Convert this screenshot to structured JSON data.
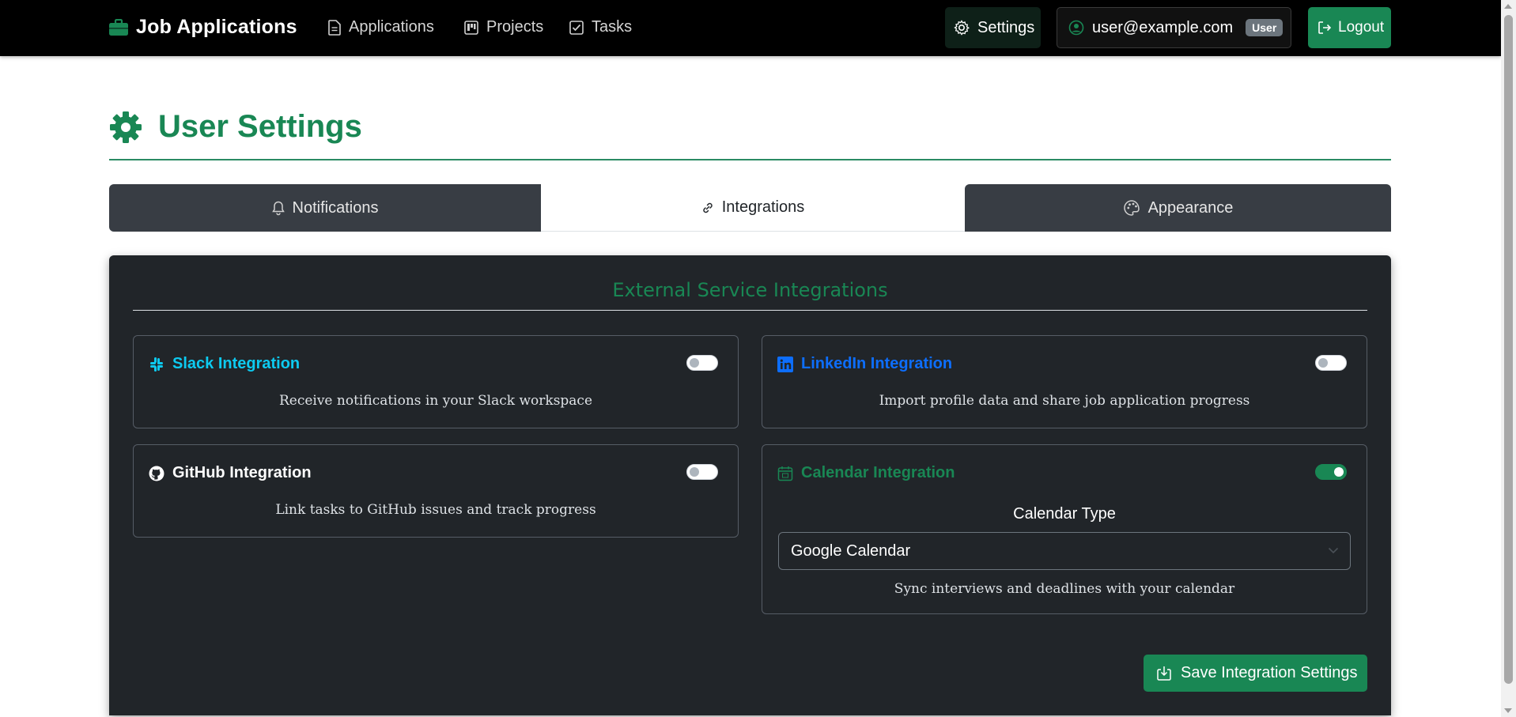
{
  "navbar": {
    "brand": "Job Applications",
    "links": [
      {
        "label": "Applications",
        "icon": "file-text-icon"
      },
      {
        "label": "Projects",
        "icon": "kanban-icon"
      },
      {
        "label": "Tasks",
        "icon": "check-square-icon"
      }
    ],
    "settings_label": "Settings",
    "user_email": "user@example.com",
    "user_role": "User",
    "logout_label": "Logout"
  },
  "page": {
    "title": "User Settings",
    "tabs": [
      {
        "label": "Notifications",
        "icon": "bell-icon",
        "active": false
      },
      {
        "label": "Integrations",
        "icon": "link-icon",
        "active": true
      },
      {
        "label": "Appearance",
        "icon": "palette-icon",
        "active": false
      }
    ]
  },
  "integrations": {
    "heading": "External Service Integrations",
    "slack": {
      "title": "Slack Integration",
      "description": "Receive notifications in your Slack workspace",
      "enabled": false,
      "color": "#0dcaf0"
    },
    "linkedin": {
      "title": "LinkedIn Integration",
      "description": "Import profile data and share job application progress",
      "enabled": false,
      "color": "#0d6efd"
    },
    "github": {
      "title": "GitHub Integration",
      "description": "Link tasks to GitHub issues and track progress",
      "enabled": false,
      "color": "#ffffff"
    },
    "calendar": {
      "title": "Calendar Integration",
      "calendar_type_label": "Calendar Type",
      "selected_calendar": "Google Calendar",
      "description": "Sync interviews and deadlines with your calendar",
      "enabled": true,
      "color": "#198754"
    },
    "save_label": "Save Integration Settings"
  },
  "colors": {
    "accent": "#198754",
    "navbar_bg": "#000000",
    "panel_bg": "#212529"
  }
}
